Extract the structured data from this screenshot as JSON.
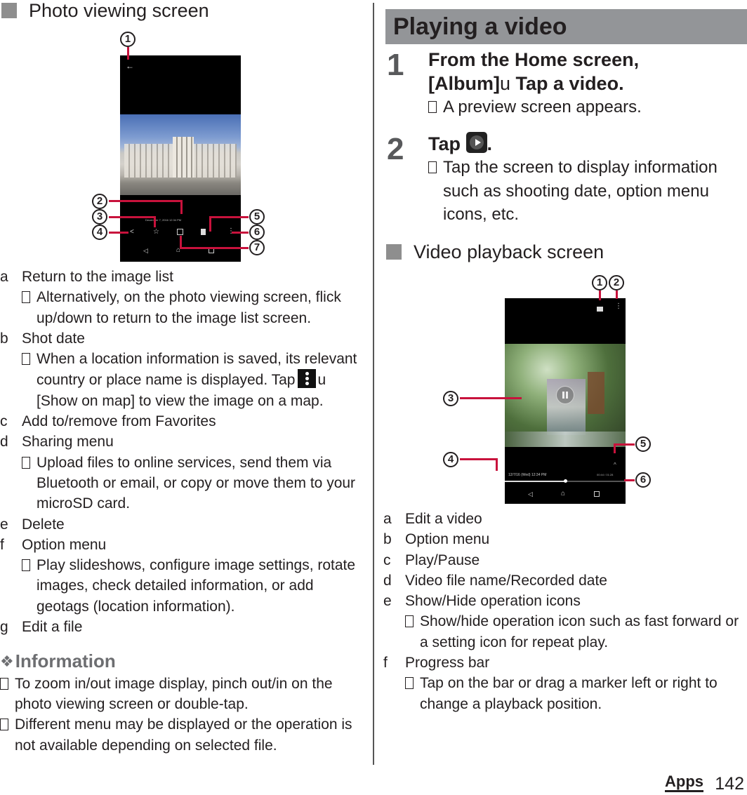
{
  "left": {
    "subsection_title": "Photo viewing screen",
    "figure": {
      "date_text": "December 7, 2016 12:34 PM",
      "callouts": [
        "1",
        "2",
        "3",
        "4",
        "5",
        "6",
        "7"
      ],
      "icons": [
        "back-arrow-icon",
        "favorite-star-icon",
        "share-icon",
        "edit-icon",
        "delete-icon",
        "more-vert-icon",
        "nav-back-icon",
        "nav-home-icon",
        "nav-recents-icon"
      ]
    },
    "items": [
      {
        "letter": "a",
        "label": "Return to the image list",
        "notes": [
          "Alternatively, on the photo viewing screen, flick up/down to return to the image list screen."
        ]
      },
      {
        "letter": "b",
        "label": "Shot date",
        "notes_parts": {
          "before": "When a location information is saved, its relevant country or place name is displayed. Tap",
          "arrow": "u",
          "after": "[Show on map] to view the image on a map."
        }
      },
      {
        "letter": "c",
        "label": "Add to/remove from Favorites"
      },
      {
        "letter": "d",
        "label": "Sharing menu",
        "notes": [
          "Upload files to online services, send them via Bluetooth or email, or copy or move them to your microSD card."
        ]
      },
      {
        "letter": "e",
        "label": "Delete"
      },
      {
        "letter": "f",
        "label": "Option menu",
        "notes": [
          "Play slideshows, configure image settings, rotate images, check detailed information, or add geotags (location information)."
        ]
      },
      {
        "letter": "g",
        "label": "Edit a file"
      }
    ],
    "information": {
      "title": "Information",
      "symbol": "❖",
      "notes": [
        "To zoom in/out image display, pinch out/in on the photo viewing screen or double-tap.",
        "Different menu may be displayed or the operation is not available depending on selected file."
      ]
    }
  },
  "right": {
    "section_title": "Playing a video",
    "steps": [
      {
        "num": "1",
        "title_line1": "From the Home screen,",
        "title_bracket": "[Album]",
        "arrow": "u",
        "title_rest": "Tap a video.",
        "notes": [
          "A preview screen appears."
        ]
      },
      {
        "num": "2",
        "title_before": "Tap",
        "title_after": ".",
        "notes": [
          "Tap the screen to display information such as shooting date, option menu icons, etc."
        ]
      }
    ],
    "subsection_title": "Video playback screen",
    "figure": {
      "date_text": "12/7/16 (Wed) 12:34 PM",
      "time_text": "00:44 / 01:28",
      "progress_fraction": 0.5,
      "callouts": [
        "1",
        "2",
        "3",
        "4",
        "5",
        "6"
      ]
    },
    "items": [
      {
        "letter": "a",
        "label": "Edit a video"
      },
      {
        "letter": "b",
        "label": "Option menu"
      },
      {
        "letter": "c",
        "label": "Play/Pause"
      },
      {
        "letter": "d",
        "label": "Video file name/Recorded date"
      },
      {
        "letter": "e",
        "label": "Show/Hide operation icons",
        "notes": [
          "Show/hide operation icon such as fast forward or a setting icon for repeat play."
        ]
      },
      {
        "letter": "f",
        "label": "Progress bar",
        "notes": [
          "Tap on the bar or drag a marker left or right to change a playback position."
        ]
      }
    ]
  },
  "footer": {
    "section": "Apps",
    "page": "142"
  },
  "colors": {
    "callout_line": "#c8123c",
    "section_bar": "#939598",
    "square_bullet": "#8e8e8e"
  }
}
